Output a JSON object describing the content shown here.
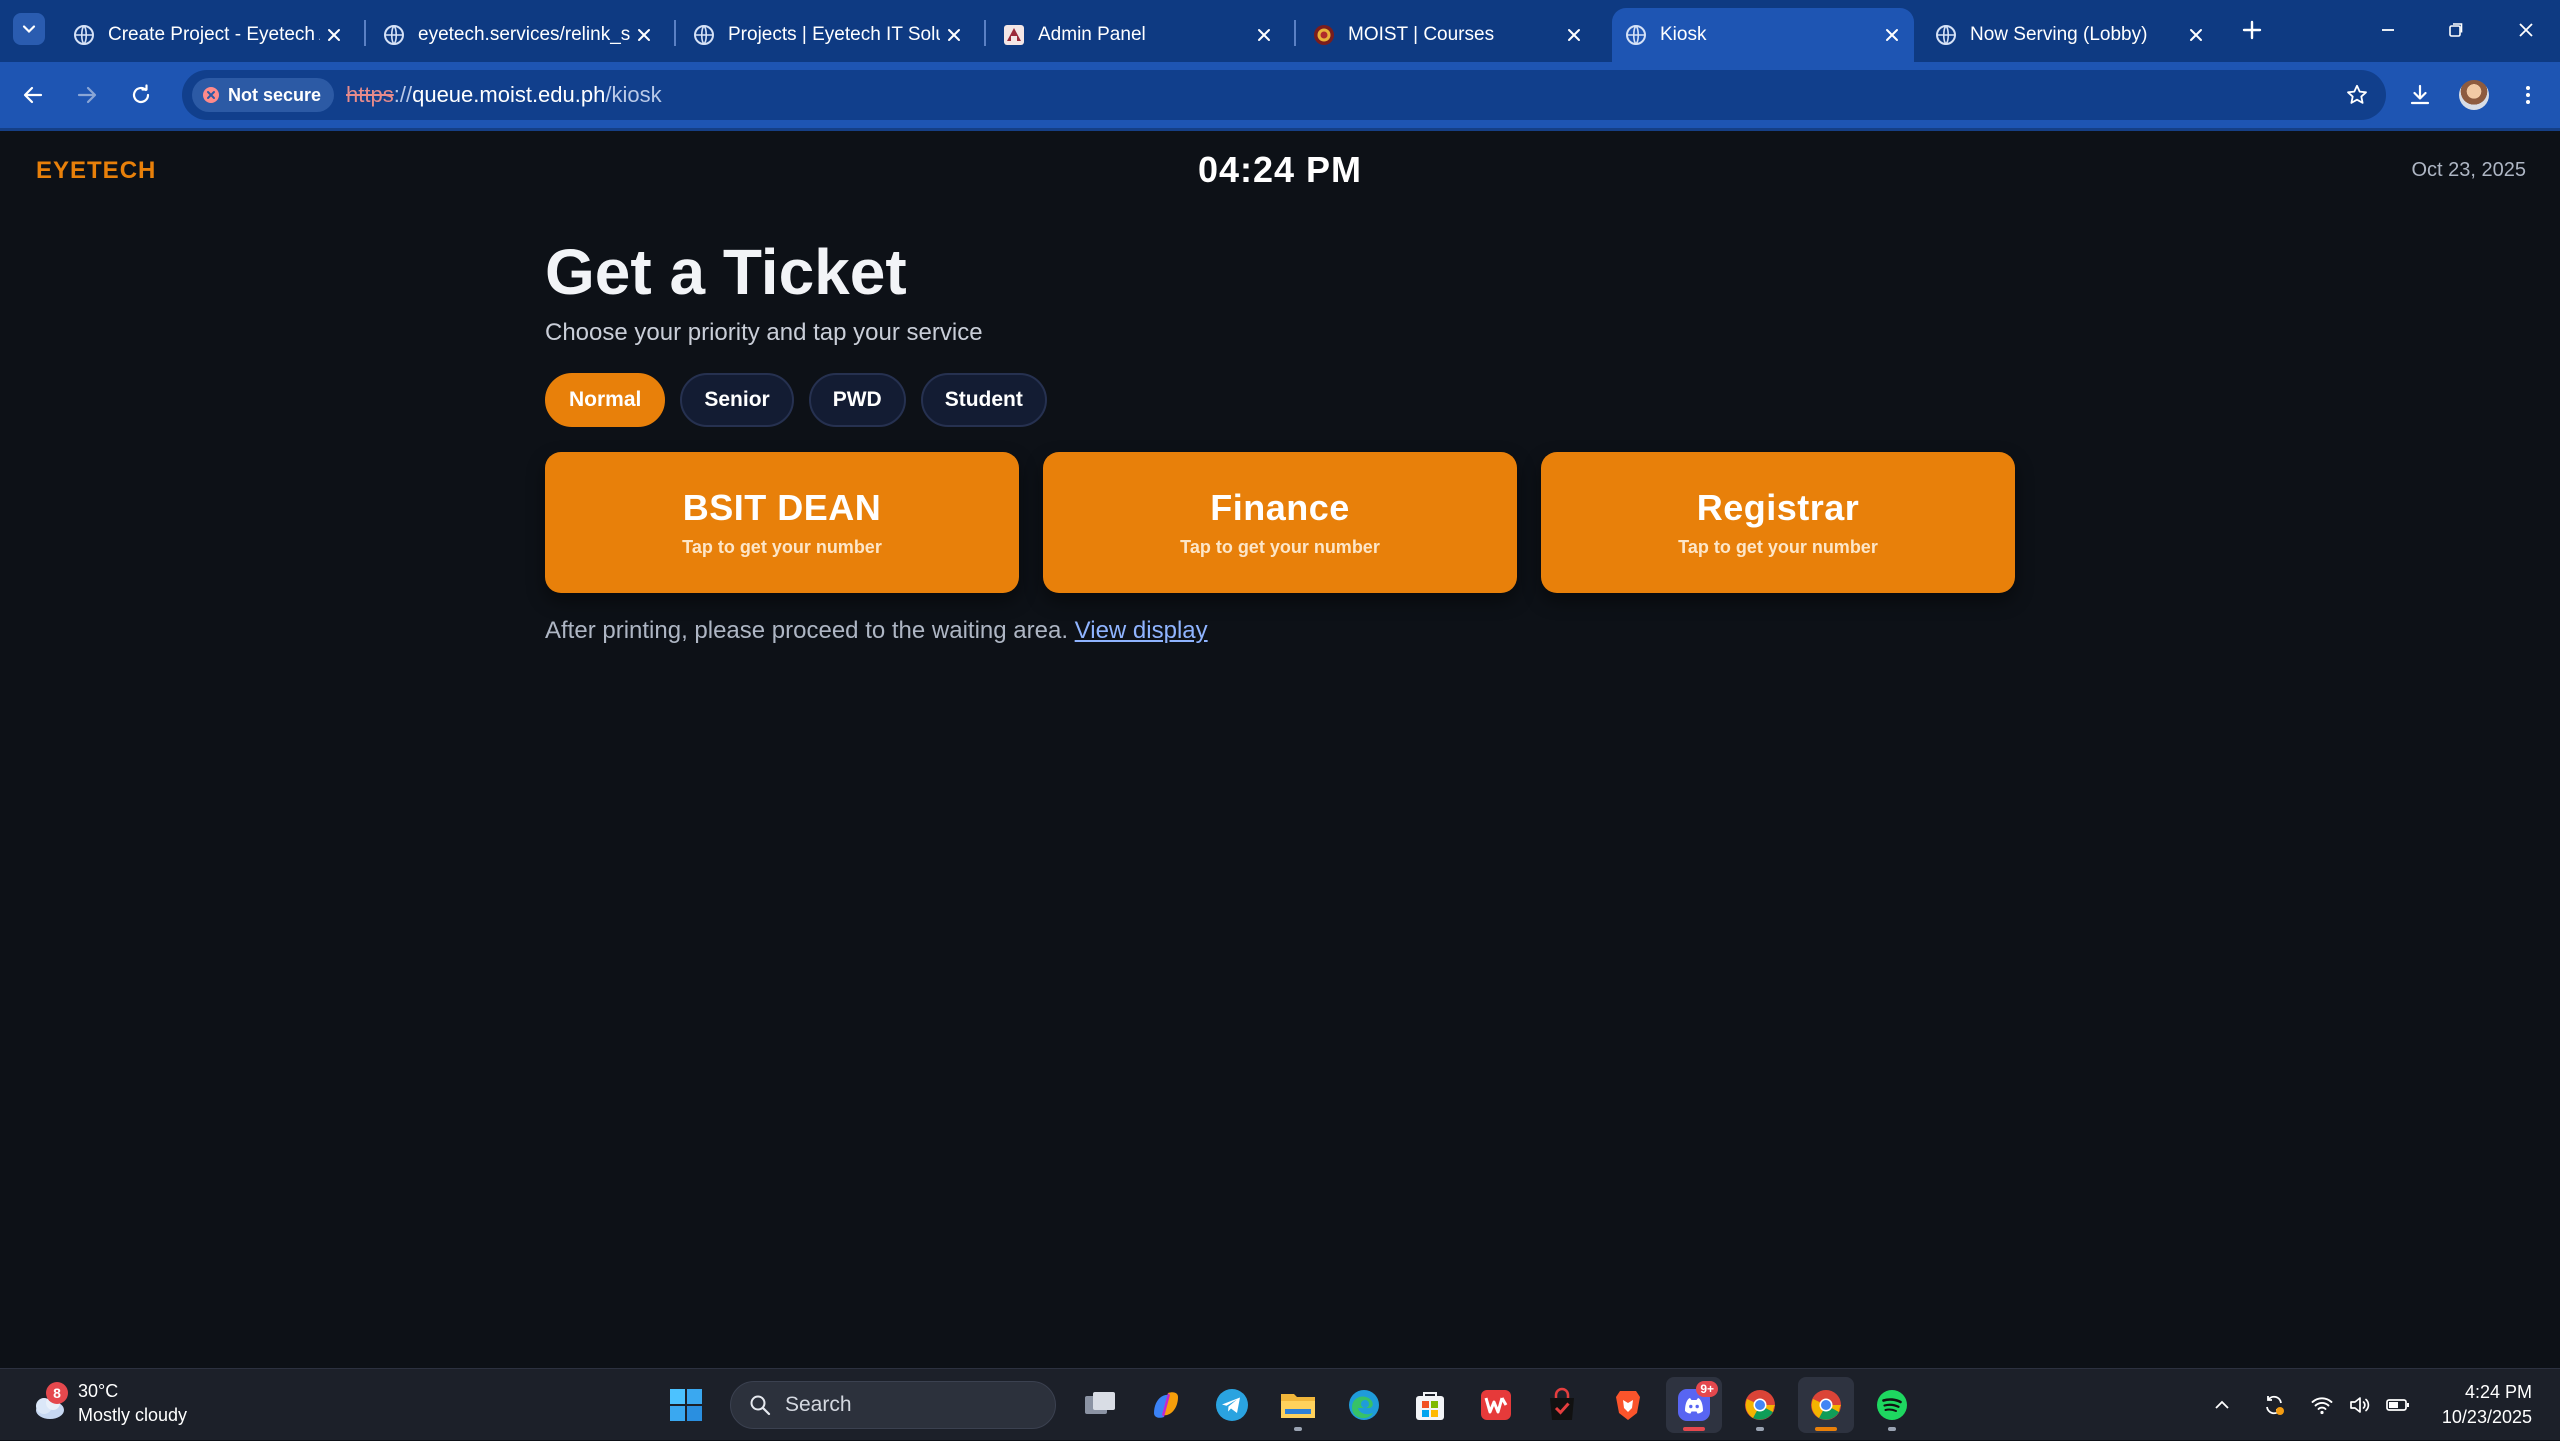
{
  "browser": {
    "tabs": [
      {
        "title": "Create Project - Eyetech A",
        "favicon": "globe-icon"
      },
      {
        "title": "eyetech.services/relink_stu",
        "favicon": "globe-icon"
      },
      {
        "title": "Projects | Eyetech IT Soluti",
        "favicon": "globe-icon"
      },
      {
        "title": "Admin Panel",
        "favicon": "admin-panel-favicon"
      },
      {
        "title": "MOIST | Courses",
        "favicon": "moist-favicon"
      },
      {
        "title": "Kiosk",
        "favicon": "globe-icon",
        "active": true
      },
      {
        "title": "Now Serving (Lobby)",
        "favicon": "globe-icon"
      }
    ],
    "security_chip": "Not secure",
    "url": {
      "scheme": "https",
      "sep": "://",
      "host": "queue.moist.edu.ph",
      "path": "/kiosk"
    }
  },
  "page": {
    "logo": "EYETECH",
    "clock": "04:24 PM",
    "date": "Oct 23, 2025",
    "heading": "Get a Ticket",
    "subheading": "Choose your priority and tap your service",
    "priorities": [
      {
        "label": "Normal",
        "active": true
      },
      {
        "label": "Senior"
      },
      {
        "label": "PWD"
      },
      {
        "label": "Student"
      }
    ],
    "services": [
      {
        "name": "BSIT DEAN",
        "hint": "Tap to get your number"
      },
      {
        "name": "Finance",
        "hint": "Tap to get your number"
      },
      {
        "name": "Registrar",
        "hint": "Tap to get your number"
      }
    ],
    "note": "After printing, please proceed to the waiting area.",
    "note_link": "View display",
    "accent_color": "#e8800a"
  },
  "taskbar": {
    "weather": {
      "badge": "8",
      "temp": "30°C",
      "desc": "Mostly cloudy"
    },
    "search_placeholder": "Search",
    "discord_badge": "9+",
    "time": "4:24 PM",
    "date": "10/23/2025"
  }
}
